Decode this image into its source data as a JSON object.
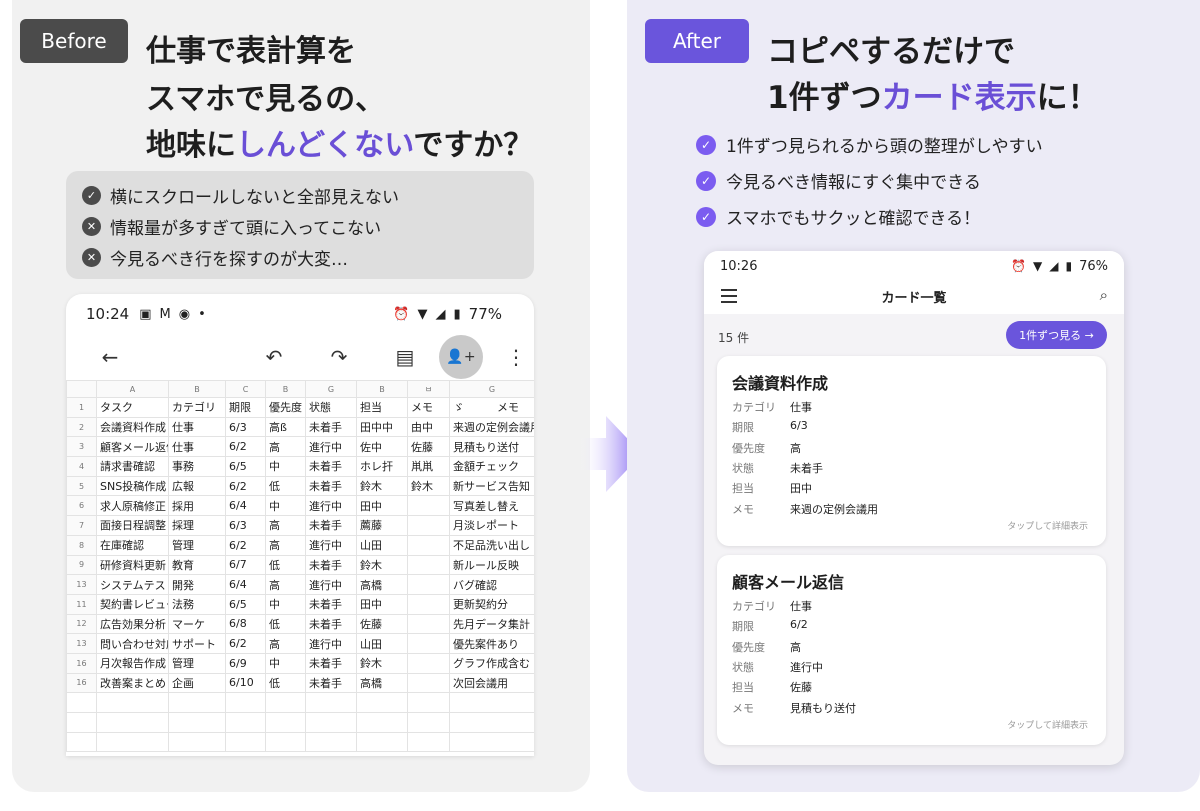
{
  "left": {
    "badge": "Before",
    "headline": {
      "line1": "仕事で表計算を",
      "line2": "スマホで見るの、",
      "line3_prefix": "地味に",
      "line3_accent": "しんどくない",
      "line3_suffix": "ですか？"
    },
    "pains": [
      {
        "icon": "check-circle-icon",
        "text": "横にスクロールしないと全部見えない"
      },
      {
        "icon": "x-circle-icon",
        "text": "情報量が多すぎて頭に入ってこない"
      },
      {
        "icon": "x-circle-icon",
        "text": "今見るべき行を探すのが大変…"
      }
    ],
    "phone": {
      "time": "10:24",
      "battery": "77%",
      "status_icons": [
        "image-icon",
        "gmail-icon",
        "app-icon",
        "dot-icon",
        "alarm-off-icon",
        "wifi-icon",
        "signal-icon",
        "battery-icon"
      ],
      "toolbar_icons": [
        "back-arrow-icon",
        "undo-icon",
        "redo-icon",
        "comment-icon",
        "add-person-icon",
        "more-vert-icon"
      ],
      "sheet": {
        "col_letters": [
          "A",
          "B",
          "C",
          "B",
          "G",
          "B",
          "ㅂ",
          "G"
        ],
        "rows": [
          {
            "n": "1",
            "cells": [
              "タスク",
              "カテゴリ",
              "期限",
              "優先度",
              "状態",
              "担当",
              "メモ",
              "ゞ　　　メモ"
            ]
          },
          {
            "n": "2",
            "cells": [
              "会議資料作成",
              "仕事",
              "6/3",
              "高ß",
              "未着手",
              "田中中",
              "由中",
              "来週の定例会議用"
            ]
          },
          {
            "n": "3",
            "cells": [
              "顧客メール返信",
              "仕事",
              "6/2",
              "高",
              "進行中",
              "佐中",
              "佐藤",
              "見積もり送付"
            ]
          },
          {
            "n": "4",
            "cells": [
              "請求書確認",
              "事務",
              "6/5",
              "中",
              "未着手",
              "ホレ扞",
              "鼡鼡",
              "金額チェック"
            ]
          },
          {
            "n": "5",
            "cells": [
              "SNS投稿作成",
              "広報",
              "6/2",
              "低",
              "未着手",
              "鈴木",
              "鈴木",
              "新サービス告知"
            ]
          },
          {
            "n": "6",
            "cells": [
              "求人原稿修正",
              "採用",
              "6/4",
              "中",
              "進行中",
              "田中",
              "",
              "写真差し替え"
            ]
          },
          {
            "n": "7",
            "cells": [
              "面接日程調整",
              "採理",
              "6/3",
              "高",
              "未着手",
              "薦藤",
              "",
              "月淡レポート"
            ]
          },
          {
            "n": "8",
            "cells": [
              "在庫確認",
              "管理",
              "6/2",
              "高",
              "進行中",
              "山田",
              "",
              "不足品洗い出し"
            ]
          },
          {
            "n": "9",
            "cells": [
              "研修資料更新",
              "教育",
              "6/7",
              "低",
              "未着手",
              "鈴木",
              "",
              "新ルール反映"
            ]
          },
          {
            "n": "13",
            "cells": [
              "システムテスト",
              "開発",
              "6/4",
              "高",
              "進行中",
              "高橋",
              "",
              "バグ確認"
            ]
          },
          {
            "n": "11",
            "cells": [
              "契約書レビュー",
              "法務",
              "6/5",
              "中",
              "未着手",
              "田中",
              "",
              "更新契約分"
            ]
          },
          {
            "n": "12",
            "cells": [
              "広告効果分析",
              "マーケ",
              "6/8",
              "低",
              "未着手",
              "佐藤",
              "",
              "先月データ集計"
            ]
          },
          {
            "n": "13",
            "cells": [
              "問い合わせ対応",
              "サポート",
              "6/2",
              "高",
              "進行中",
              "山田",
              "",
              "優先案件あり"
            ]
          },
          {
            "n": "16",
            "cells": [
              "月次報告作成",
              "管理",
              "6/9",
              "中",
              "未着手",
              "鈴木",
              "",
              "グラフ作成含む"
            ]
          },
          {
            "n": "16",
            "cells": [
              "改善案まとめ",
              "企画",
              "6/10",
              "低",
              "未着手",
              "高橋",
              "",
              "次回会議用"
            ]
          }
        ]
      }
    }
  },
  "arrow": {
    "color": "#7b5cf0"
  },
  "right": {
    "badge": "After",
    "headline": {
      "line1": "コピペするだけで",
      "line2_prefix": "1件ずつ",
      "line2_accent": "カード表示",
      "line2_suffix": "に！"
    },
    "benefits": [
      "1件ずつ見られるから頭の整理がしやすい",
      "今見るべき情報にすぐ集中できる",
      "スマホでもサクッと確認できる！"
    ],
    "phone": {
      "time": "10:26",
      "battery": "76%",
      "status_icons": [
        "alarm-icon",
        "wifi-icon",
        "signal-icon",
        "battery-icon"
      ],
      "title": "カード一覧",
      "count": "15 件",
      "one_by_one_button": "1件ずつ見る →",
      "cards": [
        {
          "title": "会議資料作成",
          "fields": [
            {
              "label": "カテゴリ",
              "value": "仕事"
            },
            {
              "label": "期限",
              "value": "6/3"
            },
            {
              "label": "優先度",
              "value": "高"
            },
            {
              "label": "状態",
              "value": "未着手"
            },
            {
              "label": "担当",
              "value": "田中"
            },
            {
              "label": "メモ",
              "value": "来週の定例会議用"
            }
          ],
          "footer": "タップして詳細表示"
        },
        {
          "title": "顧客メール返信",
          "fields": [
            {
              "label": "カテゴリ",
              "value": "仕事"
            },
            {
              "label": "期限",
              "value": "6/2"
            },
            {
              "label": "優先度",
              "value": "高"
            },
            {
              "label": "状態",
              "value": "進行中"
            },
            {
              "label": "担当",
              "value": "佐藤"
            },
            {
              "label": "メモ",
              "value": "見積もり送付"
            }
          ],
          "footer": "タップして詳細表示"
        }
      ]
    }
  },
  "colors": {
    "accent": "#6a4fd6",
    "before_badge": "#4b4b4b",
    "after_badge": "#6a55dc",
    "left_bg": "#f1f1f1",
    "right_bg": "#ecebf6"
  }
}
